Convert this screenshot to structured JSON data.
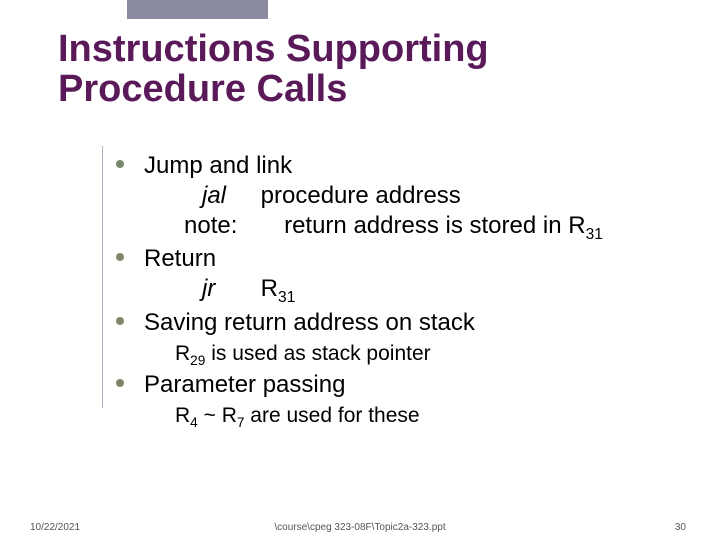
{
  "title": {
    "line1": "Instructions Supporting",
    "line2": "Procedure Calls"
  },
  "bullets": {
    "b1": {
      "head": "Jump and link",
      "op": "jal",
      "arg": "procedure address",
      "note_label": "note:",
      "note_text": "return address is stored in ",
      "note_reg": "R",
      "note_reg_sub": "31"
    },
    "b2": {
      "head": "Return",
      "op": "jr",
      "reg": "R",
      "reg_sub": "31"
    },
    "b3": {
      "head": "Saving return address on stack",
      "sub_a": "R",
      "sub_a_n": "29",
      "sub_b": " is used as stack pointer"
    },
    "b4": {
      "head": "Parameter passing",
      "sub_a": "R",
      "sub_a_n": "4",
      "sub_mid": " ~ R",
      "sub_b_n": "7",
      "sub_c": " are used for these"
    }
  },
  "footer": {
    "date": "10/22/2021",
    "path": "\\course\\cpeg 323-08F\\Topic2a-323.ppt",
    "page": "30"
  }
}
